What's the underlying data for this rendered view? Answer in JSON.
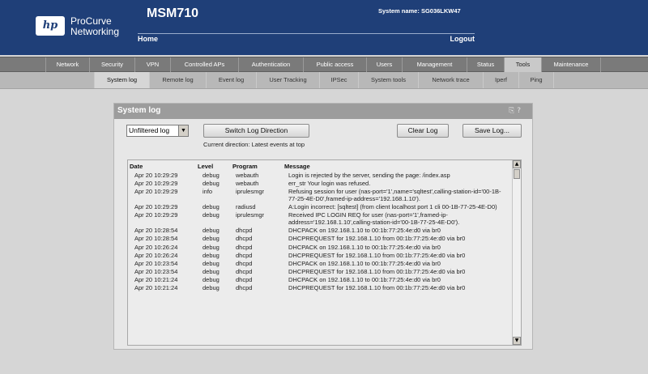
{
  "header": {
    "brand_line1": "ProCurve",
    "brand_line2": "Networking",
    "logo_text": "hp",
    "product": "MSM710",
    "system_name": "System name: SG036LKW47",
    "home": "Home",
    "logout": "Logout"
  },
  "main_nav": [
    {
      "label": "Network"
    },
    {
      "label": "Security"
    },
    {
      "label": "VPN"
    },
    {
      "label": "Controlled APs"
    },
    {
      "label": "Authentication"
    },
    {
      "label": "Public access"
    },
    {
      "label": "Users"
    },
    {
      "label": "Management"
    },
    {
      "label": "Status"
    },
    {
      "label": "Tools",
      "active": true
    },
    {
      "label": "Maintenance"
    }
  ],
  "sub_nav": [
    {
      "label": "System log",
      "active": true
    },
    {
      "label": "Remote log"
    },
    {
      "label": "Event log"
    },
    {
      "label": "User Tracking"
    },
    {
      "label": "IPSec"
    },
    {
      "label": "System tools"
    },
    {
      "label": "Network trace"
    },
    {
      "label": "Iperf"
    },
    {
      "label": "Ping"
    }
  ],
  "panel": {
    "title": "System log",
    "title_icons": "⎘ ?",
    "filter_selected": "Unfiltered log",
    "switch_button": "Switch Log Direction",
    "direction_note": "Current direction: Latest events at top",
    "clear_button": "Clear Log",
    "save_button": "Save Log...",
    "columns": {
      "date": "Date",
      "level": "Level",
      "program": "Program",
      "message": "Message"
    },
    "rows": [
      {
        "date": "Apr 20 10:29:29",
        "level": "debug",
        "program": "webauth",
        "message": "Login is rejected by the server, sending the page: /index.asp"
      },
      {
        "date": "Apr 20 10:29:29",
        "level": "debug",
        "program": "webauth",
        "message": "err_str Your login was refused."
      },
      {
        "date": "Apr 20 10:29:29",
        "level": "info",
        "program": "iprulesmgr",
        "message": "Refusing session for user (nas-port='1',name='sqltest',calling-station-id='00-1B-77-25-4E-D0',framed-ip-address='192.168.1.10')."
      },
      {
        "date": "Apr 20 10:29:29",
        "level": "debug",
        "program": "radiusd",
        "message": "A:Login incorrect: [sqltest] (from client localhost port 1 cli 00-1B-77-25-4E-D0)"
      },
      {
        "date": "Apr 20 10:29:29",
        "level": "debug",
        "program": "iprulesmgr",
        "message": "Received IPC LOGIN REQ for user (nas-port='1',framed-ip-address='192.168.1.10',calling-station-id='00-1B-77-25-4E-D0')."
      },
      {
        "date": "Apr 20 10:28:54",
        "level": "debug",
        "program": "dhcpd",
        "message": "DHCPACK on 192.168.1.10 to 00:1b:77:25:4e:d0 via br0"
      },
      {
        "date": "Apr 20 10:28:54",
        "level": "debug",
        "program": "dhcpd",
        "message": "DHCPREQUEST for 192.168.1.10 from 00:1b:77:25:4e:d0 via br0"
      },
      {
        "date": "Apr 20 10:26:24",
        "level": "debug",
        "program": "dhcpd",
        "message": "DHCPACK on 192.168.1.10 to 00:1b:77:25:4e:d0 via br0"
      },
      {
        "date": "Apr 20 10:26:24",
        "level": "debug",
        "program": "dhcpd",
        "message": "DHCPREQUEST for 192.168.1.10 from 00:1b:77:25:4e:d0 via br0"
      },
      {
        "date": "Apr 20 10:23:54",
        "level": "debug",
        "program": "dhcpd",
        "message": "DHCPACK on 192.168.1.10 to 00:1b:77:25:4e:d0 via br0"
      },
      {
        "date": "Apr 20 10:23:54",
        "level": "debug",
        "program": "dhcpd",
        "message": "DHCPREQUEST for 192.168.1.10 from 00:1b:77:25:4e:d0 via br0"
      },
      {
        "date": "Apr 20 10:21:24",
        "level": "debug",
        "program": "dhcpd",
        "message": "DHCPACK on 192.168.1.10 to 00:1b:77:25:4e:d0 via br0"
      },
      {
        "date": "Apr 20 10:21:24",
        "level": "debug",
        "program": "dhcpd",
        "message": "DHCPREQUEST for 192.168.1.10 from 00:1b:77:25:4e:d0 via br0"
      }
    ]
  }
}
